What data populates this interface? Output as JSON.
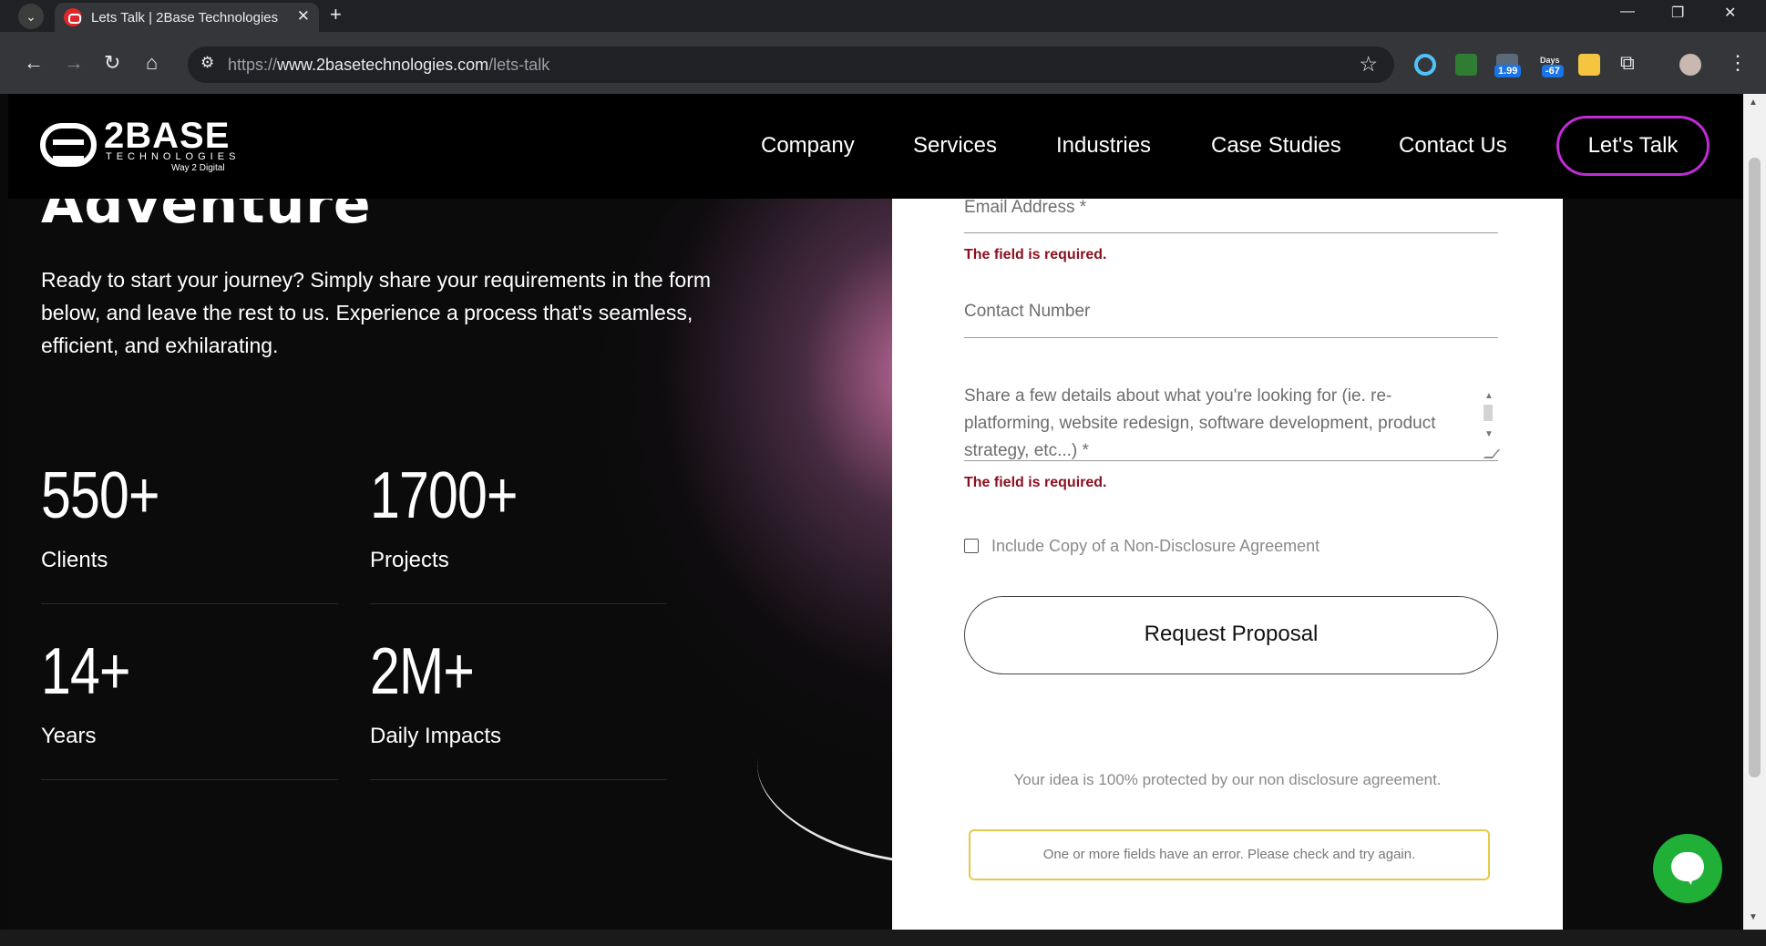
{
  "browser": {
    "tab_title": "Lets Talk | 2Base Technologies",
    "url_scheme": "https://",
    "url_host": "www.2basetechnologies.com",
    "url_path": "/lets-talk",
    "ext_badge_1": "1.99",
    "ext_days_label": "Days",
    "ext_badge_2": "-67"
  },
  "header": {
    "logo_text": "2BASE",
    "logo_sub": "TECHNOLOGIES",
    "logo_tag": "Way 2 Digital",
    "nav": [
      "Company",
      "Services",
      "Industries",
      "Case Studies",
      "Contact Us"
    ],
    "cta": "Let's Talk"
  },
  "hero": {
    "title": "Adventure",
    "text": "Ready to start your journey? Simply share your requirements in the form below, and leave the rest to us. Experience a process that's seamless, efficient, and exhilarating."
  },
  "stats": [
    {
      "value": "550+",
      "label": "Clients"
    },
    {
      "value": "1700+",
      "label": "Projects"
    },
    {
      "value": "14+",
      "label": "Years"
    },
    {
      "value": "2M+",
      "label": "Daily Impacts"
    }
  ],
  "form": {
    "email_label": "Email Address *",
    "error_required": "The field is required.",
    "contact_label": "Contact Number",
    "details_placeholder": "Share a few details about what you're looking for (ie. re-platforming, website redesign, software development, product strategy, etc...) *",
    "nda_label": "Include Copy of a Non-Disclosure Agreement",
    "submit_label": "Request Proposal",
    "protect_note": "Your idea is 100% protected by our non disclosure agreement.",
    "error_box": "One or more fields have an error. Please check and try again."
  },
  "colors": {
    "cta_border": "#c02bd6",
    "error_text": "#8a1020",
    "error_box_border": "#e7c94a",
    "chat_green": "#20b038"
  },
  "icons": {
    "chat": "chat-bubble-icon",
    "star": "bookmark-star-icon"
  }
}
